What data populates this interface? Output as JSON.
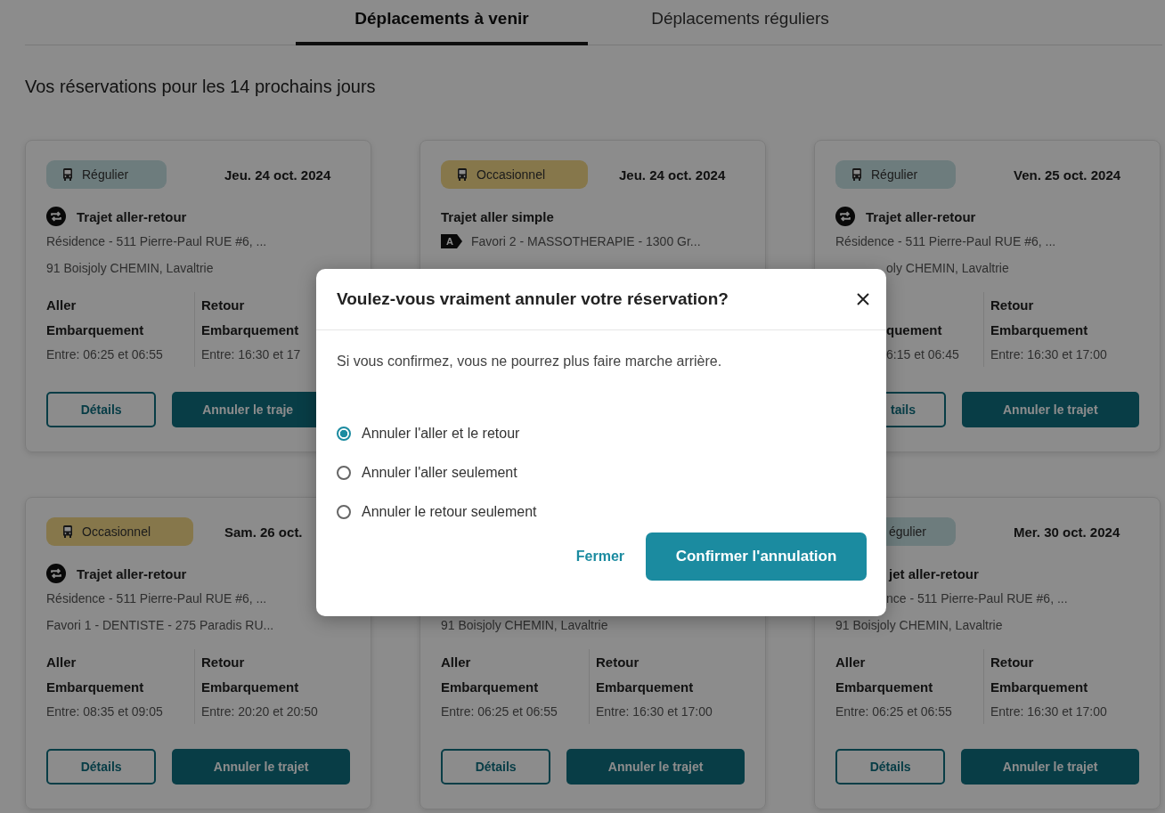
{
  "tabs": [
    {
      "label": "Déplacements à venir",
      "selected": true
    },
    {
      "label": "Déplacements réguliers",
      "selected": false
    }
  ],
  "heading": "Vos réservations pour les 14 prochains jours",
  "cards": [
    {
      "badge": {
        "label": "Régulier",
        "kind": "regular"
      },
      "date": "Jeu. 24 oct. 2024",
      "trip": {
        "label": "Trajet aller-retour",
        "kind": "round_trip"
      },
      "from": {
        "text": "Résidence - 511 Pierre-Paul RUE #6, ..."
      },
      "to": {
        "text": "91 Boisjoly CHEMIN, Lavaltrie"
      },
      "legs": [
        {
          "title": "Aller",
          "boarding": "Embarquement",
          "time": "Entre: 06:25 et 06:55"
        },
        {
          "title": "Retour",
          "boarding": "Embarquement",
          "time": "Entre: 16:30 et 17"
        }
      ],
      "details_button": "Détails",
      "cancel_button": "Annuler le traje"
    },
    {
      "badge": {
        "label": "Occasionnel",
        "kind": "occasional"
      },
      "date": "Jeu. 24 oct. 2024",
      "trip": {
        "label": "Trajet aller simple",
        "kind": "one_way"
      },
      "from": {
        "text": "Favori 2 - MASSOTHERAPIE - 1300 Gr...",
        "marker": "A"
      }
    },
    {
      "badge": {
        "label": "Régulier",
        "kind": "regular"
      },
      "date": "Ven. 25 oct. 2024",
      "trip": {
        "label": "Trajet aller-retour",
        "kind": "round_trip"
      },
      "from": {
        "text": "Résidence - 511 Pierre-Paul RUE #6, ..."
      },
      "to": {
        "text": "oly CHEMIN, Lavaltrie"
      },
      "legs": [
        {
          "boarding": "quement",
          "time": "6:15 et 06:45"
        },
        {
          "title": "Retour",
          "boarding": "Embarquement",
          "time": "Entre: 16:30 et 17:00"
        }
      ],
      "details_button": "tails",
      "cancel_button": "Annuler le trajet"
    },
    {
      "badge": {
        "label": "Occasionnel",
        "kind": "occasional"
      },
      "date": "Sam. 26 oct.",
      "trip": {
        "label": "Trajet aller-retour",
        "kind": "round_trip"
      },
      "from": {
        "text": "Résidence - 511 Pierre-Paul RUE #6, ..."
      },
      "to": {
        "text": "Favori 1 - DENTISTE - 275 Paradis RU..."
      },
      "legs": [
        {
          "title": "Aller",
          "boarding": "Embarquement",
          "time": "Entre: 08:35 et 09:05"
        },
        {
          "title": "Retour",
          "boarding": "Embarquement",
          "time": "Entre: 20:20 et 20:50"
        }
      ],
      "details_button": "Détails",
      "cancel_button": "Annuler le trajet"
    },
    {
      "to": {
        "text": "91 Boisjoly CHEMIN, Lavaltrie"
      },
      "legs": [
        {
          "title": "Aller",
          "boarding": "Embarquement",
          "time": "Entre: 06:25 et 06:55"
        },
        {
          "title": "Retour",
          "boarding": "Embarquement",
          "time": "Entre: 16:30 et 17:00"
        }
      ],
      "details_button": "Détails",
      "cancel_button": "Annuler le trajet"
    },
    {
      "badge": {
        "label": "égulier",
        "kind": "regular"
      },
      "date": "Mer. 30 oct. 2024",
      "trip": {
        "label": "jet aller-retour",
        "kind": "round_trip"
      },
      "from": {
        "text": "nce - 511 Pierre-Paul RUE #6, ..."
      },
      "to": {
        "text": "91 Boisjoly CHEMIN, Lavaltrie"
      },
      "legs": [
        {
          "title": "Aller",
          "boarding": "Embarquement",
          "time": "Entre: 06:25 et 06:55"
        },
        {
          "title": "Retour",
          "boarding": "Embarquement",
          "time": "Entre: 16:30 et 17:00"
        }
      ],
      "details_button": "Détails",
      "cancel_button": "Annuler le trajet"
    }
  ],
  "dialog": {
    "title": "Voulez-vous vraiment annuler votre réservation?",
    "message": "Si vous confirmez, vous ne pourrez plus faire marche arrière.",
    "options": [
      {
        "label": "Annuler l'aller et le retour",
        "selected": true
      },
      {
        "label": "Annuler l'aller seulement",
        "selected": false
      },
      {
        "label": "Annuler le retour seulement",
        "selected": false
      }
    ],
    "close_button": "Fermer",
    "confirm_button": "Confirmer l'annulation"
  }
}
